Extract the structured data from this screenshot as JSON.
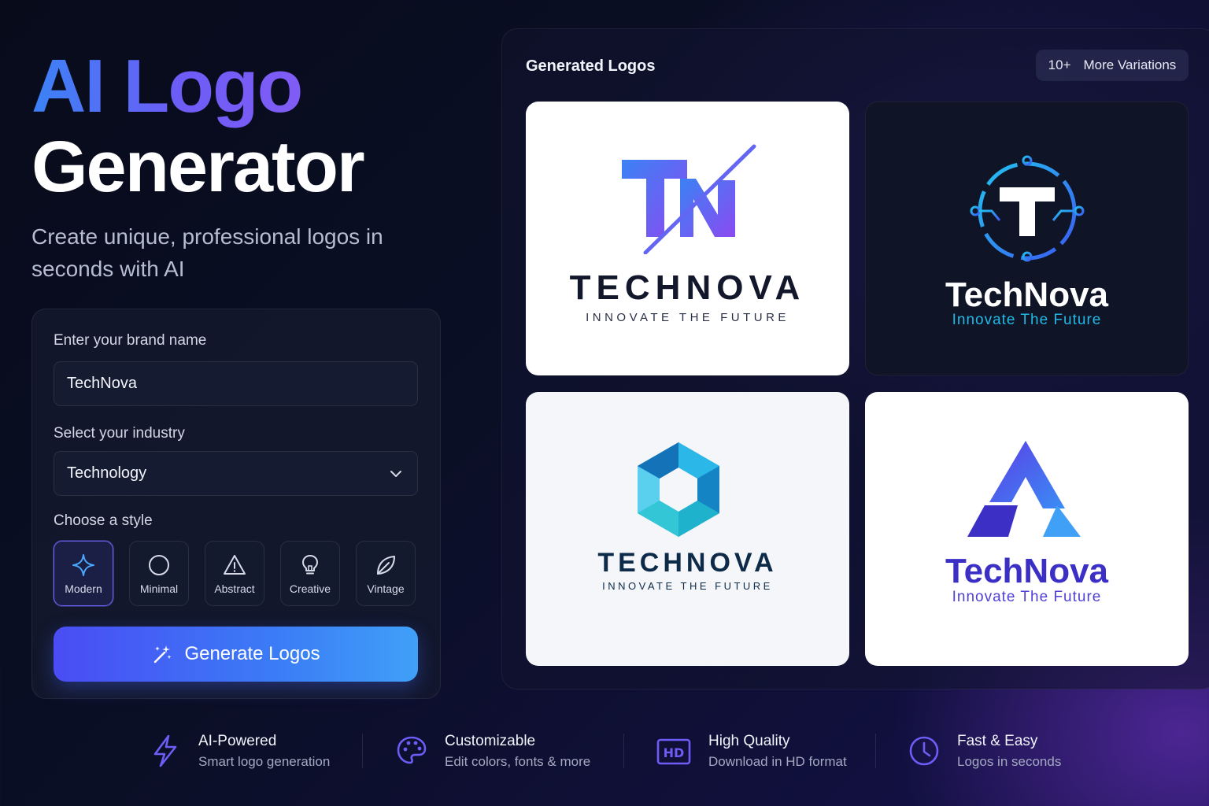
{
  "hero": {
    "title_line1": "AI Logo",
    "title_line2": "Generator",
    "subtitle": "Create unique, professional logos in seconds with AI"
  },
  "form": {
    "brand_label": "Enter your brand name",
    "brand_value": "TechNova",
    "industry_label": "Select your industry",
    "industry_value": "Technology",
    "style_label": "Choose a style",
    "styles": [
      {
        "label": "Modern",
        "icon": "sparkle-icon",
        "selected": true
      },
      {
        "label": "Minimal",
        "icon": "circle-icon",
        "selected": false
      },
      {
        "label": "Abstract",
        "icon": "triangle-icon",
        "selected": false
      },
      {
        "label": "Creative",
        "icon": "lightbulb-icon",
        "selected": false
      },
      {
        "label": "Vintage",
        "icon": "leaf-icon",
        "selected": false
      }
    ],
    "generate_label": "Generate Logos"
  },
  "results": {
    "title": "Generated Logos",
    "more_count": "10+",
    "more_label": "More Variations",
    "logos": [
      {
        "name": "TECHNOVA",
        "tagline": "INNOVATE THE FUTURE",
        "icon": "tn-monogram-icon",
        "background": "#ffffff"
      },
      {
        "name": "TechNova",
        "tagline": "Innovate The Future",
        "icon": "t-circuit-icon",
        "background": "#0f1527"
      },
      {
        "name": "TECHNOVA",
        "tagline": "INNOVATE THE FUTURE",
        "icon": "hexagon-icon",
        "background": "#f4f6fa"
      },
      {
        "name": "TechNova",
        "tagline": "Innovate The Future",
        "icon": "a-triangle-icon",
        "background": "#ffffff"
      }
    ]
  },
  "features": [
    {
      "title": "AI-Powered",
      "subtitle": "Smart logo generation",
      "icon": "lightning-icon"
    },
    {
      "title": "Customizable",
      "subtitle": "Edit colors, fonts & more",
      "icon": "palette-icon"
    },
    {
      "title": "High Quality",
      "subtitle": "Download in HD format",
      "icon": "hd-icon"
    },
    {
      "title": "Fast & Easy",
      "subtitle": "Logos in seconds",
      "icon": "clock-icon"
    }
  ],
  "colors": {
    "accent_blue": "#3b82f6",
    "accent_purple": "#8b5cf6",
    "icon_purple": "#6d5cf6"
  }
}
